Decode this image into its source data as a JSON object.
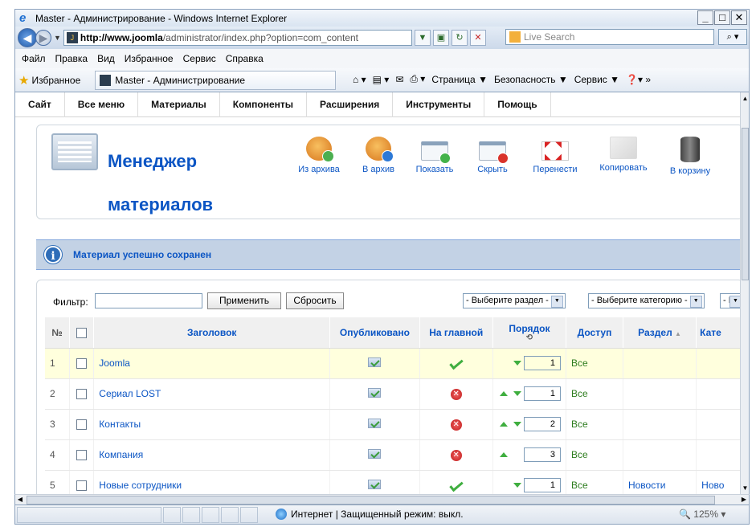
{
  "window": {
    "title": "Master - Администрирование - Windows Internet Explorer",
    "url_host": "http://www.joomla",
    "url_path": "/administrator/index.php?option=com_content",
    "search_placeholder": "Live Search"
  },
  "ie_menu": [
    "Файл",
    "Правка",
    "Вид",
    "Избранное",
    "Сервис",
    "Справка"
  ],
  "favbar": {
    "favorites_label": "Избранное",
    "tab_label": "Master - Администрирование",
    "commands": [
      "Страница ▼",
      "Безопасность ▼",
      "Сервис ▼"
    ]
  },
  "admin_menu": [
    "Сайт",
    "Все меню",
    "Материалы",
    "Компоненты",
    "Расширения",
    "Инструменты",
    "Помощь"
  ],
  "toolbar": {
    "title_line1": "Менеджер",
    "title_line2": "материалов",
    "buttons": [
      {
        "label": "Из архива",
        "icon": "unarchive-icon"
      },
      {
        "label": "В архив",
        "icon": "archive-icon"
      },
      {
        "label": "Показать",
        "icon": "publish-icon"
      },
      {
        "label": "Скрыть",
        "icon": "unpublish-icon"
      },
      {
        "label": "Перенести",
        "icon": "move-icon"
      },
      {
        "label": "Копировать",
        "icon": "copy-icon"
      },
      {
        "label": "В корзину",
        "icon": "trash-icon"
      }
    ]
  },
  "message": "Материал успешно сохранен",
  "filter": {
    "label": "Фильтр:",
    "value": "",
    "apply": "Применить",
    "reset": "Сбросить",
    "section_select": "- Выберите раздел -",
    "category_select": "- Выберите категорию -",
    "author_select": "- Вы"
  },
  "table": {
    "headers": {
      "num": "№",
      "title": "Заголовок",
      "published": "Опубликовано",
      "frontpage": "На главной",
      "order": "Порядок",
      "access": "Доступ",
      "section": "Раздел",
      "category": "Кате"
    },
    "rows": [
      {
        "num": "1",
        "title": "Joomla",
        "frontpage": "yes",
        "up": false,
        "down": true,
        "order": "1",
        "access": "Все",
        "section": "",
        "category": ""
      },
      {
        "num": "2",
        "title": "Сериал LOST",
        "frontpage": "no",
        "up": true,
        "down": true,
        "order": "1",
        "access": "Все",
        "section": "",
        "category": ""
      },
      {
        "num": "3",
        "title": "Контакты",
        "frontpage": "no",
        "up": true,
        "down": true,
        "order": "2",
        "access": "Все",
        "section": "",
        "category": ""
      },
      {
        "num": "4",
        "title": "Компания",
        "frontpage": "no",
        "up": true,
        "down": false,
        "order": "3",
        "access": "Все",
        "section": "",
        "category": ""
      },
      {
        "num": "5",
        "title": "Новые сотрудники",
        "frontpage": "yes",
        "up": false,
        "down": true,
        "order": "1",
        "access": "Все",
        "section": "Новости",
        "category": "Ново"
      }
    ]
  },
  "status": {
    "zone": "Интернет | Защищенный режим: выкл.",
    "zoom": "125%"
  }
}
